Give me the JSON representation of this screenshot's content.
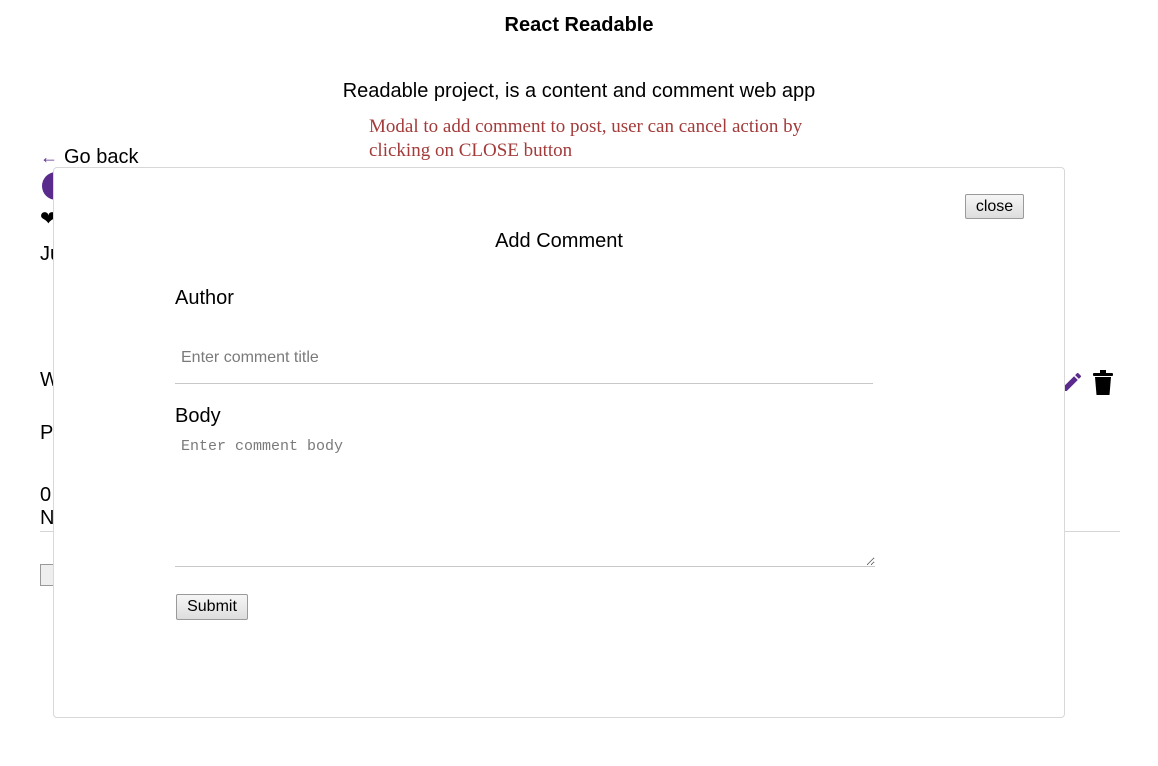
{
  "app": {
    "title": "React Readable",
    "subtitle": "Readable project, is a content and comment web app"
  },
  "annotation": {
    "text": "Modal to add comment to post, user can cancel action by clicking on CLOSE button",
    "color": "#a33b3b"
  },
  "navigation": {
    "go_back_arrow": "←",
    "go_back_label": "Go back"
  },
  "background_post": {
    "avatar_color": "#5a2a8c",
    "heart_glyph": "❤",
    "date_fragment": "Ju",
    "title_fragment": "W",
    "body_fragment": "P",
    "votes_fragment": "0",
    "comments_fragment": "N",
    "edit_icon": "pencil-icon",
    "delete_icon": "trash-icon",
    "accent_color": "#5a2a8c"
  },
  "modal": {
    "close_label": "close",
    "title": "Add Comment",
    "author_label": "Author",
    "author_placeholder": "Enter comment title",
    "author_value": "",
    "body_label": "Body",
    "body_placeholder": "Enter comment body",
    "body_value": "",
    "submit_label": "Submit"
  }
}
